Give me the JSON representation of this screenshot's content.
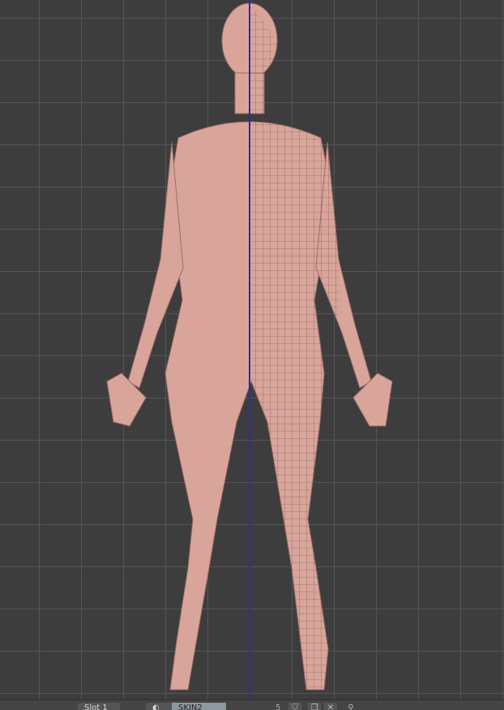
{
  "viewport": {
    "label": "3D viewport - front orthographic",
    "skin_color": "#d9a59b",
    "axis_color": "#2a2ab8"
  },
  "material_bar": {
    "slot": "Slot 1",
    "material_name": "SKIN2",
    "user_count": "5",
    "icons": [
      "shading-sphere-icon",
      "fake-user-icon",
      "duplicate-icon",
      "unlink-icon",
      "pin-icon"
    ]
  }
}
